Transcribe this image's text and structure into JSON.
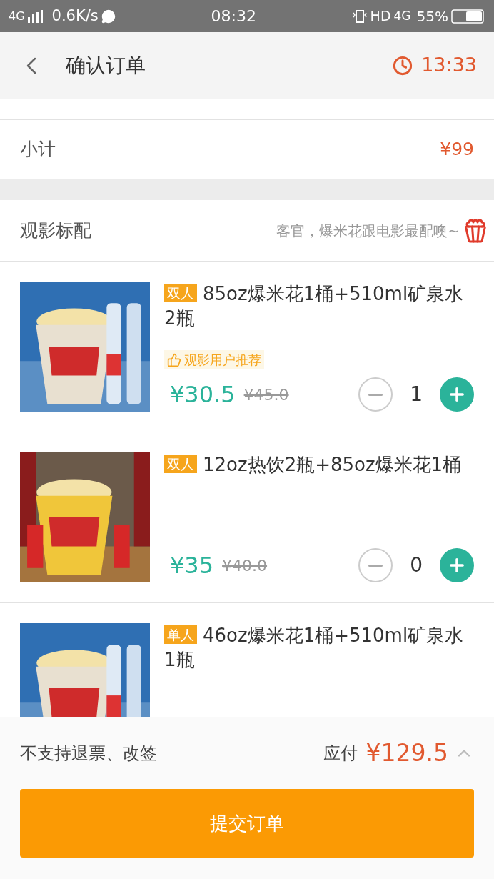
{
  "status_bar": {
    "network": "4G",
    "speed": "0.6K/s",
    "time": "08:32",
    "hd": "HD",
    "data": "4G",
    "battery": "55%"
  },
  "header": {
    "title": "确认订单",
    "countdown": "13:33"
  },
  "subtotal": {
    "label": "小计",
    "value": "¥99"
  },
  "section": {
    "title": "观影标配",
    "hint": "客官，爆米花跟电影最配噢~"
  },
  "items": [
    {
      "tag": "双人",
      "name": "85oz爆米花1桶+510ml矿泉水2瓶",
      "recommend": "观影用户推荐",
      "price": "¥30.5",
      "old_price": "¥45.0",
      "quantity": "1"
    },
    {
      "tag": "双人",
      "name": "12oz热饮2瓶+85oz爆米花1桶",
      "price": "¥35",
      "old_price": "¥40.0",
      "quantity": "0"
    },
    {
      "tag": "单人",
      "name": "46oz爆米花1桶+510ml矿泉水1瓶"
    }
  ],
  "footer": {
    "notice": "不支持退票、改签",
    "due_label": "应付",
    "due": "¥129.5",
    "submit": "提交订单"
  }
}
